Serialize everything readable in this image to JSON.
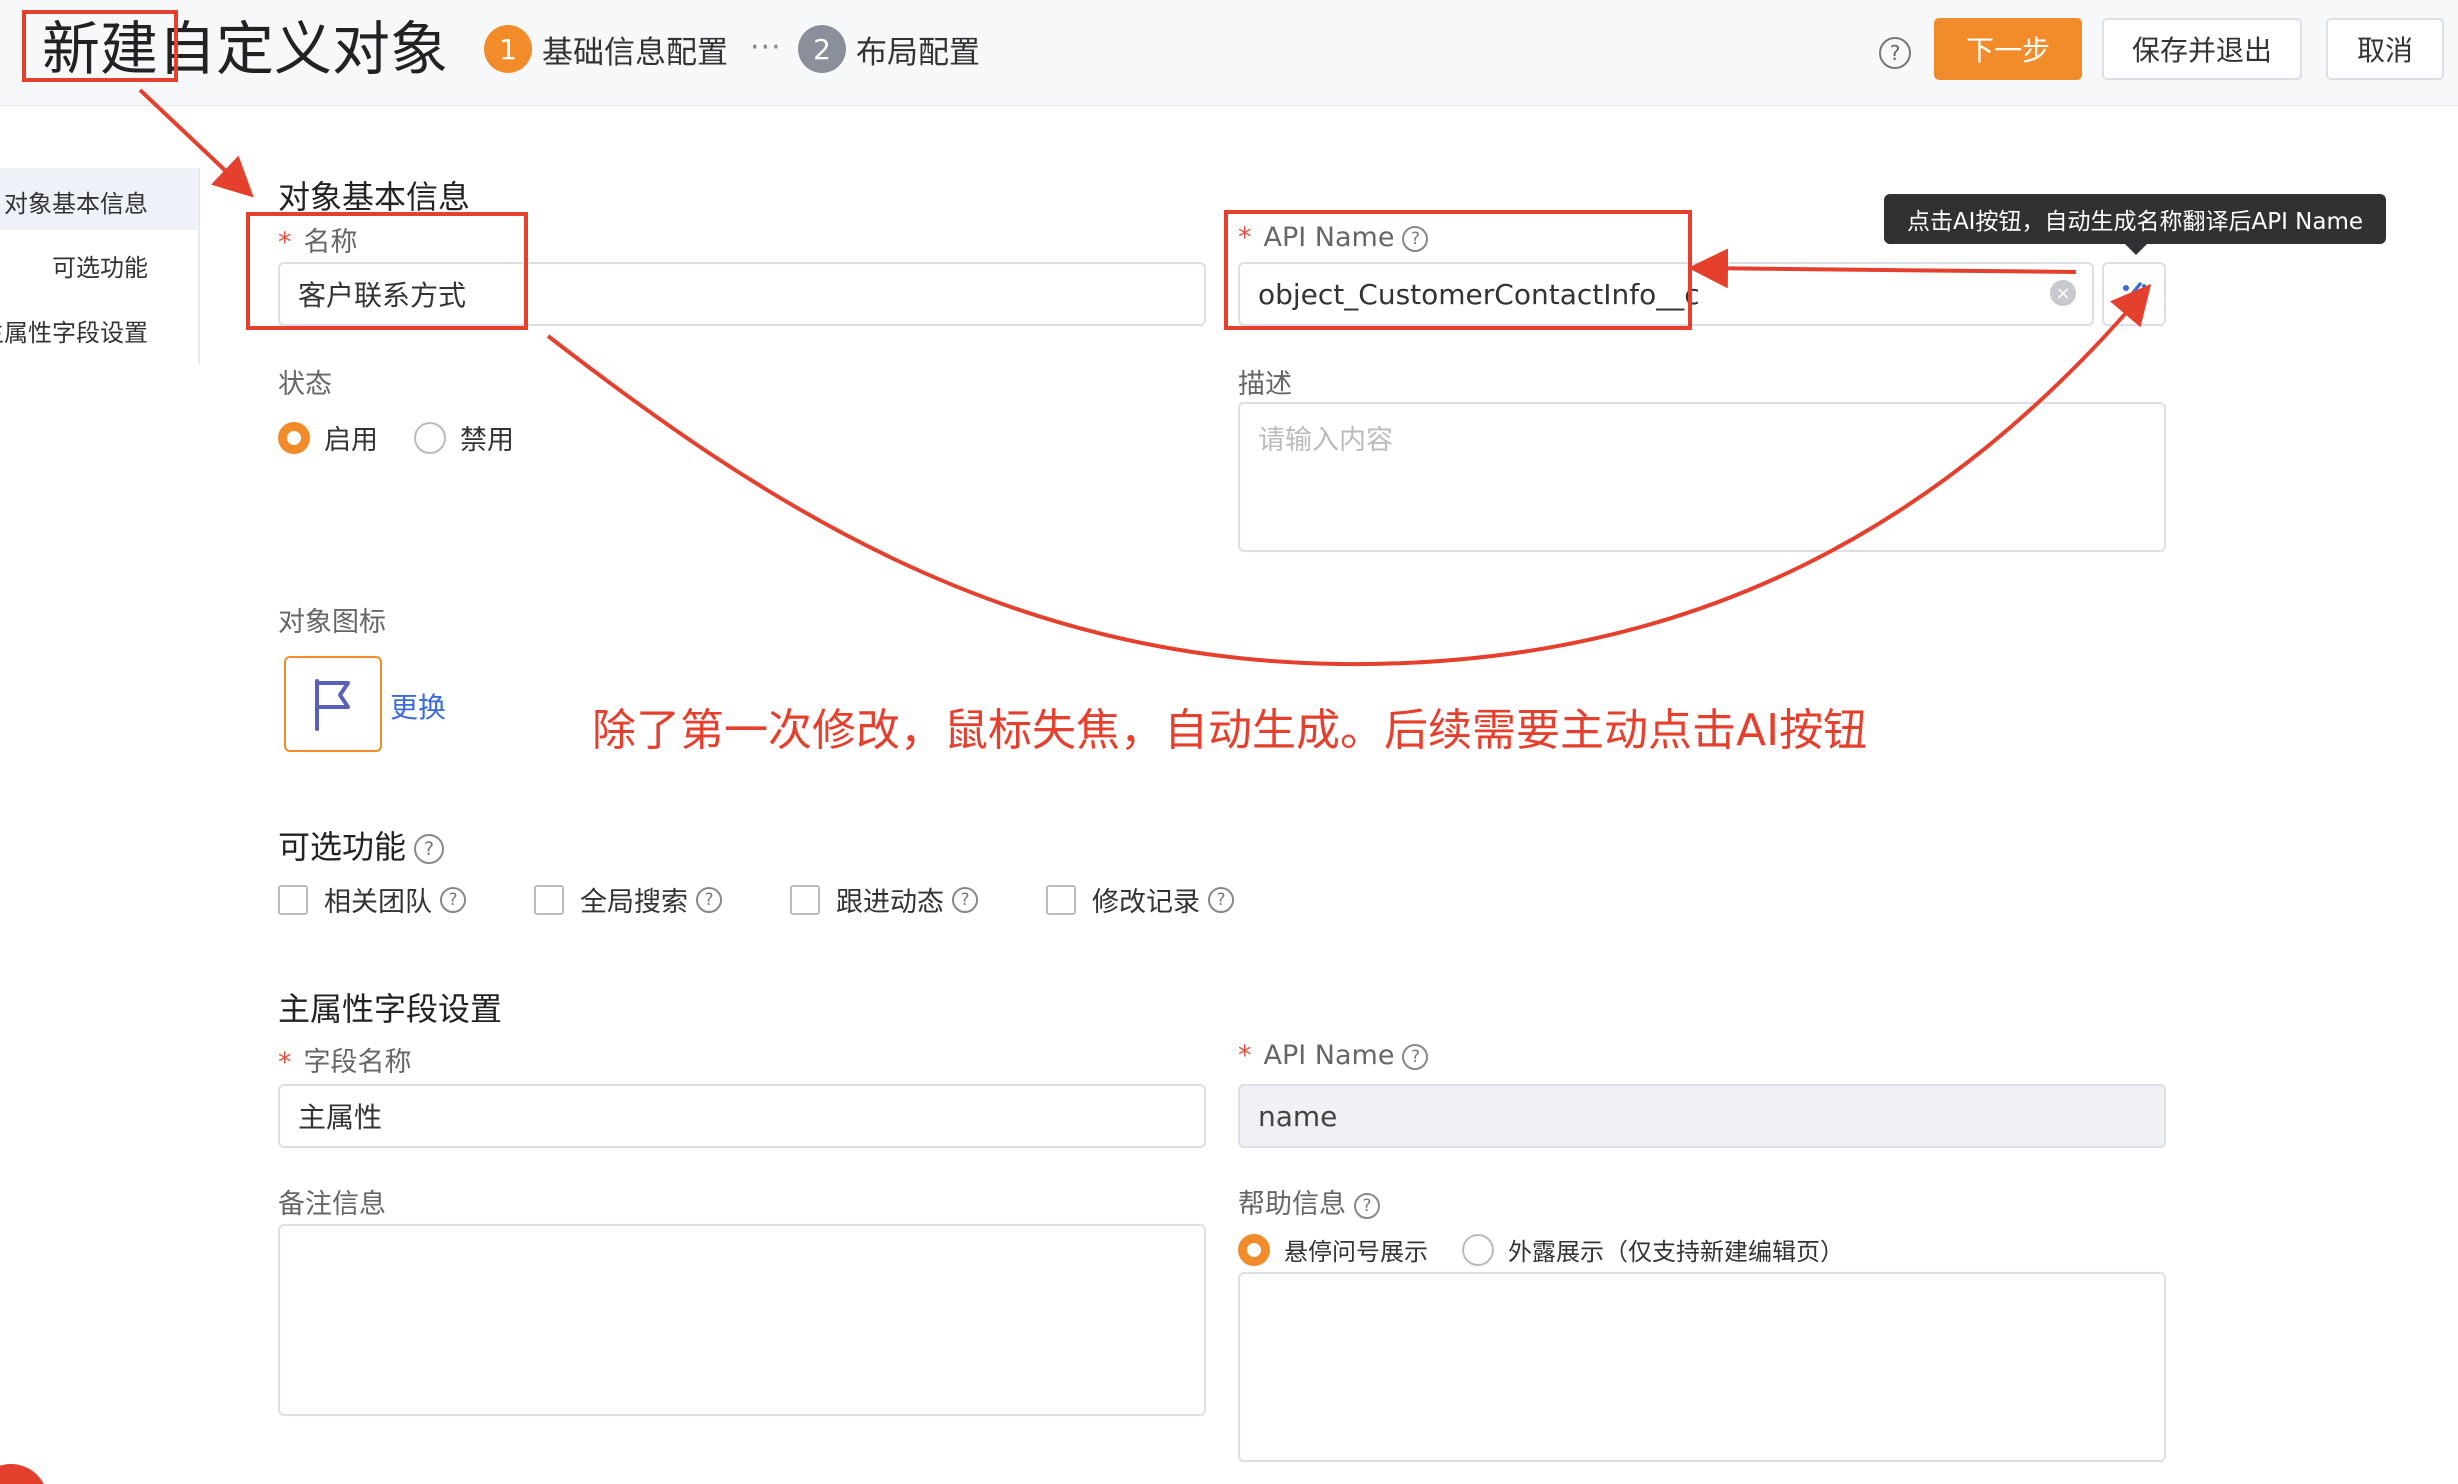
{
  "header": {
    "title": "新建自定义对象",
    "steps": [
      {
        "num": "1",
        "label": "基础信息配置"
      },
      {
        "num": "2",
        "label": "布局配置"
      }
    ],
    "step_separator": "···",
    "help": "?",
    "buttons": {
      "next": "下一步",
      "save_exit": "保存并退出",
      "cancel": "取消"
    }
  },
  "sidenav": {
    "items": [
      "对象基本信息",
      "可选功能",
      "主属性字段设置"
    ]
  },
  "basic_info": {
    "title": "对象基本信息",
    "name_label": "名称",
    "name_value": "客户联系方式",
    "api_label": "API Name",
    "api_value": "object_CustomerContactInfo__c",
    "status_label": "状态",
    "status_options": [
      "启用",
      "禁用"
    ],
    "desc_label": "描述",
    "desc_placeholder": "请输入内容",
    "icon_label": "对象图标",
    "icon_change": "更换",
    "tooltip": "点击AI按钮，自动生成名称翻译后API Name"
  },
  "optional": {
    "title": "可选功能",
    "items": [
      "相关团队",
      "全局搜索",
      "跟进动态",
      "修改记录"
    ]
  },
  "primary_field": {
    "title": "主属性字段设置",
    "field_name_label": "字段名称",
    "field_name_value": "主属性",
    "api_label": "API Name",
    "api_value": "name",
    "remark_label": "备注信息",
    "help_label": "帮助信息",
    "help_options": [
      "悬停问号展示",
      "外露展示（仅支持新建编辑页）"
    ]
  },
  "annotation": {
    "text": "除了第一次修改，鼠标失焦，自动生成。后续需要主动点击AI按钮",
    "color": "#e5402e"
  },
  "colors": {
    "accent": "#f28c2a",
    "link": "#3a6bd9"
  }
}
